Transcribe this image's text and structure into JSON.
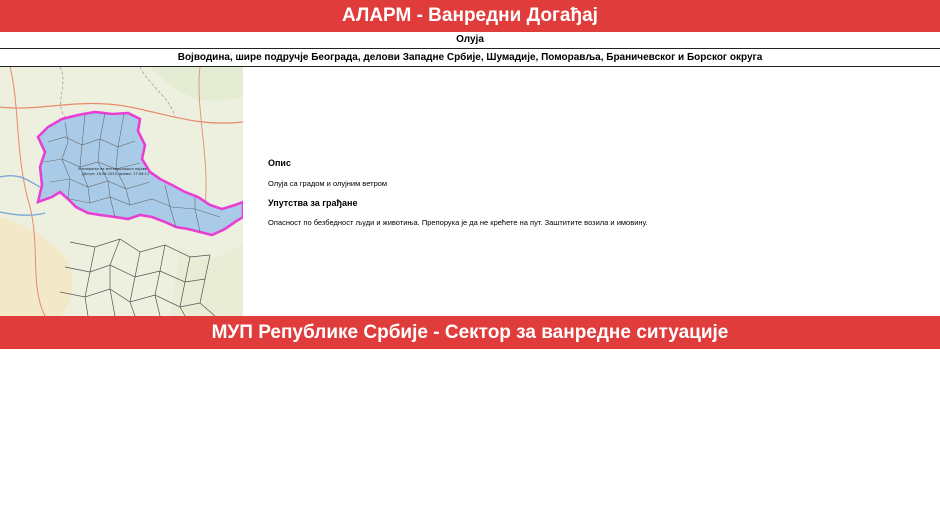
{
  "header": {
    "title": "АЛАРМ - Ванредни Догађај"
  },
  "event": {
    "type": "Олуја",
    "area": "Војводина, шире подручје Београда, делови Западне Србије, Шумадије, Поморавља, Браничевског и Борског округа"
  },
  "map": {
    "label_line1": "Упозорење на метеоролошке појаве",
    "label_line2": "Датум: 18.06.2025, време: 17:56:11",
    "colors": {
      "region_fill": "#a9cbe8",
      "region_border": "#e83fd3",
      "district_lines": "#6a6a6a"
    }
  },
  "info": {
    "description_heading": "Опис",
    "description_text": "Олуја са градом и олујним ветром",
    "instructions_heading": "Упутства за грађане",
    "instructions_text": "Опасност по безбедност људи и животиња. Препорука је да не крећете на пут. Заштитите возила и имовину."
  },
  "footer": {
    "title": "МУП Републике Србије - Сектор за ванредне ситуације"
  },
  "colors": {
    "banner": "#e03c3c"
  }
}
